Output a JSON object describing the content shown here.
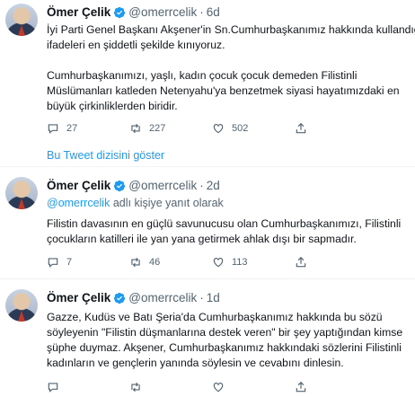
{
  "tweets": [
    {
      "name": "Ömer Çelik",
      "handle": "@omerrcelik",
      "time": "6d",
      "replying": null,
      "lines_a": [
        "İyi Parti Genel Başkanı Akşener'in Sn.Cumhurbaşkanımız hakkında kullandığı",
        "ifadeleri en şiddetli şekilde kınıyoruz."
      ],
      "lines_b": [
        "Cumhurbaşkanımızı, yaşlı, kadın çocuk çocuk demeden Filistinli",
        "Müslümanları katleden Netenyahu'ya benzetmek siyasi hayatımızdaki en",
        "büyük çirkinliklerden biridir."
      ],
      "replies": "27",
      "retweets": "227",
      "likes": "502"
    },
    {
      "name": "Ömer Çelik",
      "handle": "@omerrcelik",
      "time": "2d",
      "replying_mention": "@omerrcelik",
      "replying_text": " adlı kişiye yanıt olarak",
      "lines_a": [
        "Filistin davasının en güçlü savunucusu olan Cumhurbaşkanımızı, Filistinli",
        "çocukların katilleri ile yan yana getirmek ahlak dışı bir sapmadır."
      ],
      "replies": "7",
      "retweets": "46",
      "likes": "113"
    },
    {
      "name": "Ömer Çelik",
      "handle": "@omerrcelik",
      "time": "1d",
      "lines_a": [
        "Gazze, Kudüs ve Batı Şeria'da Cumhurbaşkanımız hakkında bu sözü",
        "söyleyenin \"Filistin düşmanlarına destek veren\" bir şey yaptığından kimse",
        "şüphe duymaz. Akşener, Cumhurbaşkanımız hakkındaki sözlerini Filistinli",
        "kadınların ve gençlerin yanında söylesin ve cevabını dinlesin."
      ],
      "replies": "",
      "retweets": "",
      "likes": ""
    }
  ],
  "show_thread": "Bu Tweet dizisini göster",
  "icons": [
    "verified-badge-icon",
    "reply-icon",
    "retweet-icon",
    "like-icon",
    "share-icon"
  ],
  "colors": {
    "accent": "#1d9bf0",
    "muted": "#536471",
    "text": "#0f1419"
  }
}
